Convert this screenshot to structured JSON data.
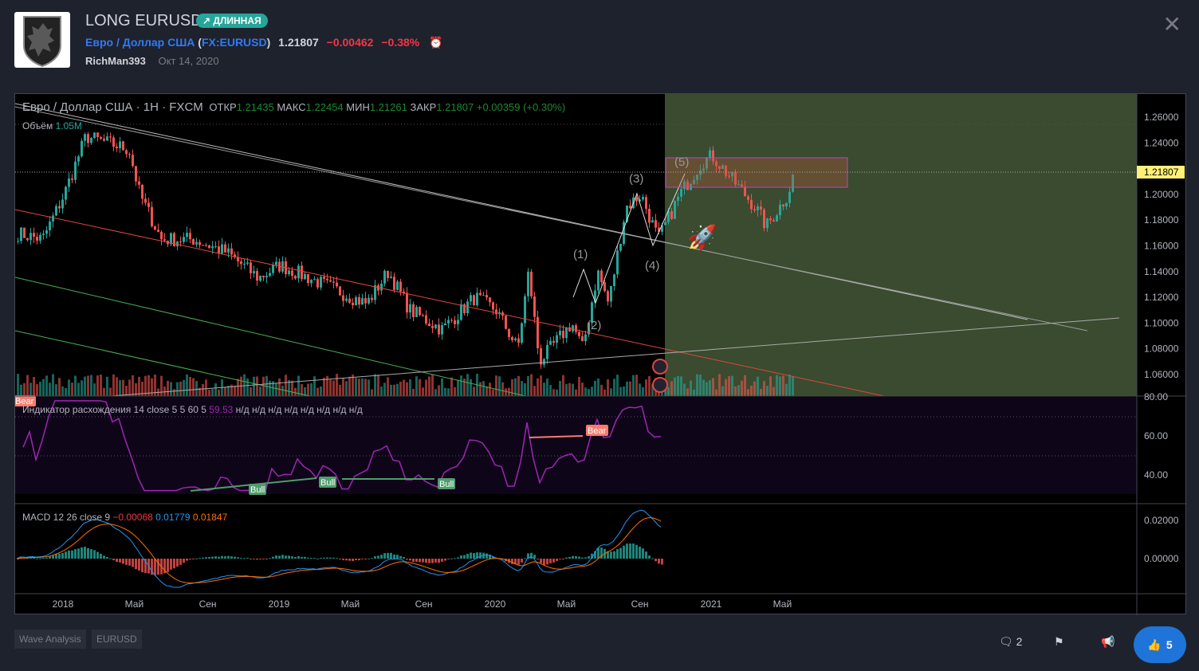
{
  "header": {
    "title": "LONG EURUSD",
    "badge": "ДЛИННАЯ",
    "symbol_name": "Евро / Доллар США",
    "symbol_code": "FX:EURUSD",
    "price": "1.21807",
    "change": "−0.00462",
    "change_pct": "−0.38%",
    "author": "RichMan393",
    "date": "Окт 14, 2020"
  },
  "legend": {
    "title": "Евро / Доллар США · 1H · FXCM",
    "o_label": "ОТКР",
    "o": "1.21435",
    "h_label": "МАКС",
    "h": "1.22454",
    "l_label": "МИН",
    "l": "1.21261",
    "c_label": "ЗАКР",
    "c": "1.21807",
    "chg": "+0.00359 (+0.30%)",
    "volume_label": "Объём",
    "volume": "1.05M"
  },
  "rsi": {
    "label": "Индикатор расхождения 14 close 5 5 60 5",
    "value": "59.53",
    "na": "н/д н/д н/д н/д н/д н/д н/д н/д",
    "labels": [
      "Bear",
      "Bull",
      "Bull",
      "Bear",
      "Bull"
    ]
  },
  "macd": {
    "label": "MACD 12 26 close 9",
    "hist": "−0.00068",
    "macd": "0.01779",
    "signal": "0.01847"
  },
  "waves": [
    "(1)",
    "(2)",
    "(3)",
    "(4)",
    "(5)"
  ],
  "price_axis": [
    "1.26000",
    "1.24000",
    "1.20000",
    "1.18000",
    "1.16000",
    "1.14000",
    "1.12000",
    "1.10000",
    "1.08000",
    "1.06000"
  ],
  "current_price": "1.21807",
  "rsi_axis": [
    "80.00",
    "60.00",
    "40.00"
  ],
  "macd_axis": [
    "0.02000",
    "0.00000"
  ],
  "time_axis": [
    "2018",
    "Май",
    "Сен",
    "2019",
    "Май",
    "Сен",
    "2020",
    "Май",
    "Сен",
    "2021",
    "Май"
  ],
  "tags": [
    "Wave Analysis",
    "EURUSD"
  ],
  "actions": {
    "comments": "2",
    "likes": "5"
  },
  "colors": {
    "up": "#26a69a",
    "down": "#ef5350",
    "rsi": "#9c27b0",
    "macd": "#2196f3",
    "signal": "#ff6d00",
    "accent": "#1e74d8"
  },
  "chart_data": {
    "type": "candlestick",
    "price_path": [
      [
        2017.78,
        1.17
      ],
      [
        2017.9,
        1.165
      ],
      [
        2018.0,
        1.2
      ],
      [
        2018.1,
        1.245
      ],
      [
        2018.3,
        1.235
      ],
      [
        2018.35,
        1.2
      ],
      [
        2018.45,
        1.165
      ],
      [
        2018.6,
        1.165
      ],
      [
        2018.75,
        1.155
      ],
      [
        2018.9,
        1.135
      ],
      [
        2019.0,
        1.145
      ],
      [
        2019.2,
        1.13
      ],
      [
        2019.4,
        1.115
      ],
      [
        2019.5,
        1.14
      ],
      [
        2019.6,
        1.11
      ],
      [
        2019.75,
        1.095
      ],
      [
        2019.9,
        1.12
      ],
      [
        2020.0,
        1.11
      ],
      [
        2020.1,
        1.08
      ],
      [
        2020.15,
        1.14
      ],
      [
        2020.2,
        1.07
      ],
      [
        2020.35,
        1.1
      ],
      [
        2020.4,
        1.08
      ],
      [
        2020.47,
        1.14
      ],
      [
        2020.52,
        1.115
      ],
      [
        2020.6,
        1.19
      ],
      [
        2020.67,
        1.2
      ],
      [
        2020.75,
        1.165
      ],
      [
        2020.85,
        1.2
      ],
      [
        2020.95,
        1.225
      ],
      [
        2021.0,
        1.23
      ],
      [
        2021.1,
        1.21
      ],
      [
        2021.2,
        1.19
      ],
      [
        2021.25,
        1.175
      ],
      [
        2021.35,
        1.2
      ],
      [
        2021.38,
        1.218
      ]
    ],
    "ylim": [
      1.05,
      1.27
    ]
  }
}
